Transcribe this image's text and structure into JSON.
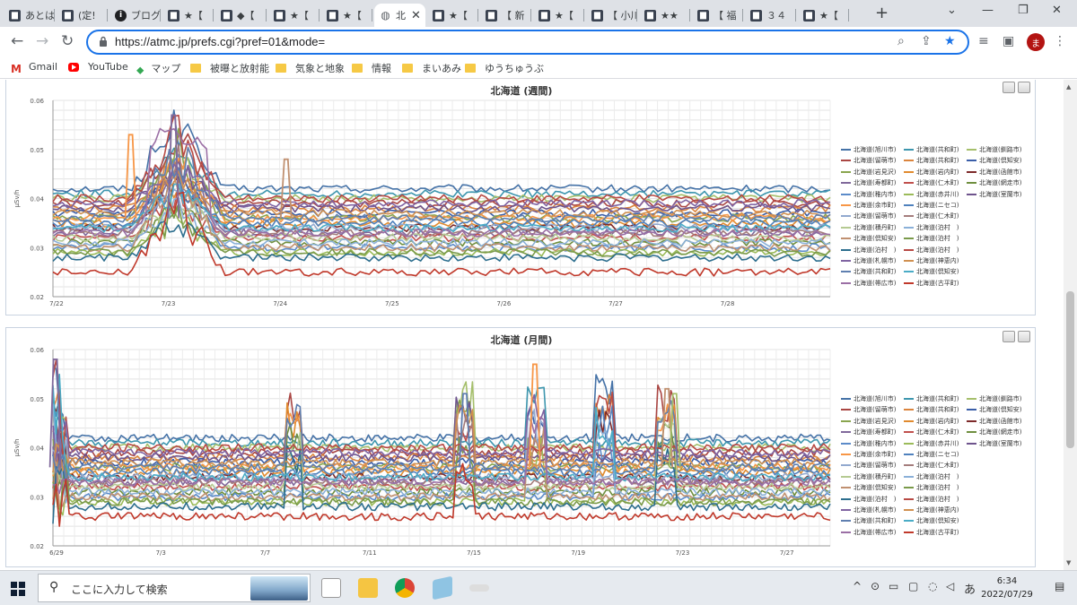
{
  "browser": {
    "tabs": [
      {
        "label": "あとは",
        "icon": "site-icon"
      },
      {
        "label": "(定!",
        "icon": "site-icon"
      },
      {
        "label": "ブログ",
        "icon": "info-icon"
      },
      {
        "label": "★【",
        "icon": "site-icon"
      },
      {
        "label": "◆【",
        "icon": "site-icon"
      },
      {
        "label": "★【",
        "icon": "site-icon"
      },
      {
        "label": "★【",
        "icon": "site-icon"
      },
      {
        "label": "北",
        "icon": "globe-icon",
        "active": true
      },
      {
        "label": "★【",
        "icon": "site-icon"
      },
      {
        "label": "【 新",
        "icon": "site-icon"
      },
      {
        "label": "★【",
        "icon": "site-icon"
      },
      {
        "label": "【 小川",
        "icon": "site-icon"
      },
      {
        "label": "★★",
        "icon": "site-icon"
      },
      {
        "label": "【 福",
        "icon": "site-icon"
      },
      {
        "label": "３４",
        "icon": "site-icon"
      },
      {
        "label": "★【",
        "icon": "site-icon"
      }
    ],
    "url": "https://atmc.jp/prefs.cgi?pref=01&mode=",
    "profile_initial": "ま",
    "bookmarks": [
      {
        "label": "Gmail",
        "icon": "gmail-icon"
      },
      {
        "label": "YouTube",
        "icon": "youtube-icon"
      },
      {
        "label": "マップ",
        "icon": "maps-icon"
      },
      {
        "label": "被曝と放射能",
        "icon": "folder-icon"
      },
      {
        "label": "気象と地象",
        "icon": "folder-icon"
      },
      {
        "label": "情報",
        "icon": "folder-icon"
      },
      {
        "label": "まいあみ",
        "icon": "folder-icon"
      },
      {
        "label": "ゆうちゅうぶ",
        "icon": "folder-icon"
      }
    ]
  },
  "legend_labels": [
    "北海道(旭川市)",
    "北海道(共和町)",
    "北海道(釧路市)",
    "北海道(留萌市)",
    "北海道(共和町)",
    "北海道(倶知安)",
    "北海道(岩見沢)",
    "北海道(岩内町)",
    "北海道(函館市)",
    "北海道(寿都町)",
    "北海道(仁木町)",
    "北海道(網走市)",
    "北海道(稚内市)",
    "北海道(赤井川)",
    "北海道(室蘭市)",
    "北海道(余市町)",
    "北海道(ニセコ)",
    "北海道(留萌市)",
    "北海道(仁木町)",
    "北海道(積丹町)",
    "北海道(泊村　)",
    "北海道(倶知安)",
    "北海道(泊村　)",
    "北海道(泊村　)",
    "北海道(泊村　)",
    "北海道(札幌市)",
    "北海道(神恵内)",
    "北海道(共和町)",
    "北海道(倶知安)",
    "北海道(帯広市)",
    "北海道(古平町)"
  ],
  "series_colors": [
    "#4572a7",
    "#3d96ae",
    "#a5bf6b",
    "#aa4643",
    "#db843d",
    "#3a5ea8",
    "#89a54e",
    "#e08a2e",
    "#7d2a2a",
    "#80699b",
    "#c0504d",
    "#6f8f3f",
    "#5b8bc9",
    "#9bbb59",
    "#6e548d",
    "#f79646",
    "#4f81bd",
    "#92a9cf",
    "#a47d7c",
    "#b5ca92",
    "#8ab0d8",
    "#c09070",
    "#7a9a4a",
    "#2c6e8e",
    "#b84a44",
    "#8064a2",
    "#d09050",
    "#5f7fb0",
    "#4aacc6",
    "#9b6fa5",
    "#c0392b"
  ],
  "charts": [
    {
      "title": "北海道 (週間)",
      "ylabel": "μSv/h",
      "y_ticks": [
        "0.06",
        "0.05",
        "0.04",
        "0.03",
        "0.02"
      ],
      "x_ticks": [
        "7/22",
        "7/23",
        "7/24",
        "7/25",
        "7/26",
        "7/27",
        "7/28"
      ]
    },
    {
      "title": "北海道 (月間)",
      "ylabel": "μSv/h",
      "y_ticks": [
        "0.06",
        "0.05",
        "0.04",
        "0.03",
        "0.02"
      ],
      "x_ticks": [
        "6/29",
        "7/3",
        "7/7",
        "7/11",
        "7/15",
        "7/19",
        "7/23",
        "7/27"
      ]
    }
  ],
  "chart_data": [
    {
      "type": "line",
      "title": "北海道 (週間)",
      "ylabel": "μSv/h",
      "ylim": [
        0.02,
        0.06
      ],
      "x_range": [
        "7/22",
        "7/28"
      ],
      "grid": true,
      "legend": "right",
      "series_baselines": [
        0.042,
        0.041,
        0.04,
        0.039,
        0.038,
        0.037,
        0.036,
        0.035,
        0.034,
        0.033,
        0.032,
        0.031,
        0.03,
        0.029,
        0.038,
        0.036,
        0.035,
        0.034,
        0.033,
        0.032,
        0.031,
        0.03,
        0.029,
        0.028,
        0.04,
        0.039,
        0.037,
        0.036,
        0.034,
        0.033,
        0.025
      ],
      "notable_peaks": [
        {
          "x": "7/23",
          "series": "北海道(帯広市)",
          "y": 0.057
        },
        {
          "x": "7/22 PM",
          "series": "北海道(岩見沢)",
          "y": 0.053
        },
        {
          "x": "7/24",
          "series": "北海道(旭川市)",
          "y": 0.048
        }
      ]
    },
    {
      "type": "line",
      "title": "北海道 (月間)",
      "ylabel": "μSv/h",
      "ylim": [
        0.02,
        0.06
      ],
      "x_range": [
        "6/29",
        "7/28"
      ],
      "grid": true,
      "legend": "right",
      "series_baselines": [
        0.042,
        0.041,
        0.04,
        0.039,
        0.038,
        0.037,
        0.036,
        0.035,
        0.034,
        0.033,
        0.032,
        0.031,
        0.03,
        0.029,
        0.038,
        0.036,
        0.035,
        0.034,
        0.033,
        0.032,
        0.031,
        0.03,
        0.029,
        0.028,
        0.04,
        0.039,
        0.037,
        0.036,
        0.034,
        0.033,
        0.026
      ],
      "notable_peaks": [
        {
          "x": "6/29",
          "series": "北海道(旭川市)",
          "y": 0.058
        },
        {
          "x": "7/17",
          "series": "北海道(岩見沢)",
          "y": 0.057
        },
        {
          "x": "7/21",
          "series": "北海道(旭川市)",
          "y": 0.052
        },
        {
          "x": "7/13",
          "series": "北海道(余市町)",
          "y": 0.051
        },
        {
          "x": "7/22",
          "series": "北海道(岩見沢)",
          "y": 0.051
        }
      ]
    }
  ],
  "taskbar": {
    "search_placeholder": "ここに入力して検索",
    "ime_indicator": "あ",
    "time": "6:34",
    "date": "2022/07/29"
  }
}
